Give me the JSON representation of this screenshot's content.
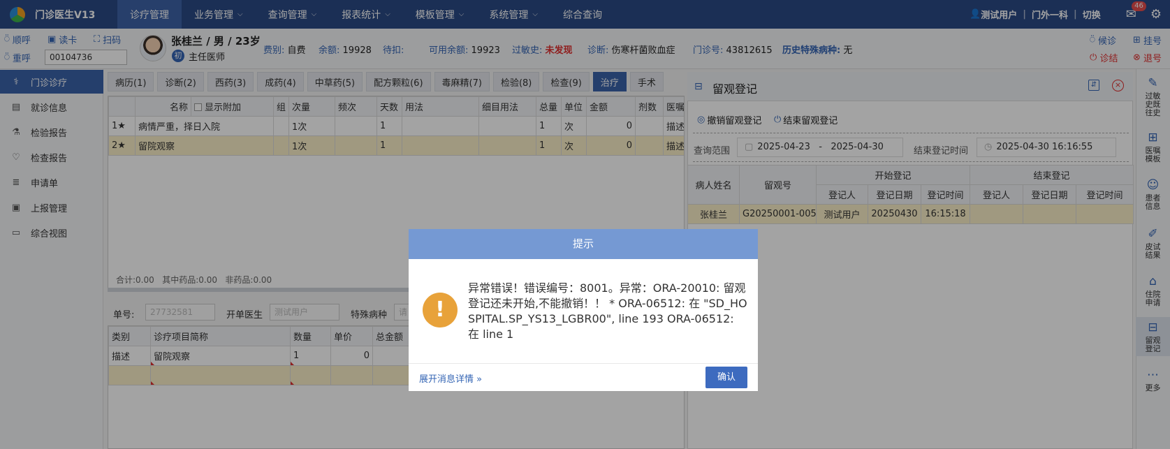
{
  "app": {
    "title": "门诊医生V13"
  },
  "nav": [
    {
      "label": "诊疗管理",
      "chev": false
    },
    {
      "label": "业务管理",
      "chev": true
    },
    {
      "label": "查询管理",
      "chev": true
    },
    {
      "label": "报表统计",
      "chev": true
    },
    {
      "label": "模板管理",
      "chev": true
    },
    {
      "label": "系统管理",
      "chev": true
    },
    {
      "label": "综合查询",
      "chev": false
    }
  ],
  "topright": {
    "user": "测试用户",
    "dept": "门外一科",
    "switch": "切换",
    "mail_count": "46"
  },
  "toolbar": {
    "shunhu": "顺呼",
    "duka": "读卡",
    "saoma": "扫码",
    "chonghu": "重呼",
    "card_no": "00104736"
  },
  "patient": {
    "name_line": "张桂兰 / 男 / 23岁",
    "chu": "初",
    "doctor_title": "主任医师",
    "fee_type_label": "费别:",
    "fee_type": "自费",
    "balance_label": "余额:",
    "balance": "19928",
    "deduct_label": "待扣:",
    "deduct": "",
    "avail_label": "可用余额:",
    "avail": "19923",
    "allergy_label": "过敏史:",
    "allergy": "未发现",
    "diag_label": "诊断:",
    "diag": "伤寒杆菌败血症",
    "visit_label": "门诊号:",
    "visit": "43812615",
    "special_label": "历史特殊病种:",
    "special": "无"
  },
  "right_tools": {
    "houzhen": "候诊",
    "guahao": "挂号",
    "zhenjie": "诊结",
    "tuihao": "退号"
  },
  "sidebar": [
    {
      "label": "门诊诊疗",
      "icon": "stethoscope-icon",
      "glyph": "⚕"
    },
    {
      "label": "就诊信息",
      "icon": "card-icon",
      "glyph": "▤"
    },
    {
      "label": "检验报告",
      "icon": "flask-icon",
      "glyph": "⚗"
    },
    {
      "label": "检查报告",
      "icon": "heart-icon",
      "glyph": "♡"
    },
    {
      "label": "申请单",
      "icon": "form-icon",
      "glyph": "≣"
    },
    {
      "label": "上报管理",
      "icon": "clipboard-icon",
      "glyph": "▣"
    },
    {
      "label": "综合视图",
      "icon": "monitor-icon",
      "glyph": "▭"
    }
  ],
  "tabs": [
    "病历(1)",
    "诊断(2)",
    "西药(3)",
    "成药(4)",
    "中草药(5)",
    "配方颗粒(6)",
    "毒麻精(7)",
    "检验(8)",
    "检查(9)",
    "治疗",
    "手术"
  ],
  "grid1": {
    "headers": [
      "",
      "名称",
      "显示附加",
      "组",
      "次量",
      "频次",
      "天数",
      "用法",
      "细目用法",
      "总量",
      "单位",
      "金额",
      "剂数",
      "医嘱"
    ],
    "rows": [
      [
        "1★",
        "病情严重，择日入院",
        "",
        "1次",
        "",
        "1",
        "",
        "",
        "1",
        "次",
        "0",
        "",
        "描述"
      ],
      [
        "2★",
        "留院观察",
        "",
        "1次",
        "",
        "1",
        "",
        "",
        "1",
        "次",
        "0",
        "",
        "描述"
      ]
    ],
    "footer": "合计:0.00   其中药品:0.00   非药品:0.00"
  },
  "lowerform": {
    "danhao_label": "单号:",
    "danhao": "27732581",
    "doctor_label": "开单医生",
    "doctor": "测试用户",
    "special_label": "特殊病种",
    "special": "请"
  },
  "grid2": {
    "headers": [
      "类别",
      "诊疗项目简称",
      "数量",
      "单价",
      "总金额"
    ],
    "rows": [
      [
        "描述",
        "留院观察",
        "1",
        "0",
        ""
      ]
    ]
  },
  "panel": {
    "title": "留观登记",
    "cancel_btn": "撤销留观登记",
    "end_btn": "结束留观登记",
    "range_label": "查询范围",
    "range": "2025-04-23   -   2025-04-30",
    "end_time_label": "结束登记时间",
    "end_time": "2025-04-30 16:16:55",
    "grid": {
      "group_start": "开始登记",
      "group_end": "结束登记",
      "col_name": "病人姓名",
      "col_no": "留观号",
      "sub": [
        "登记人",
        "登记日期",
        "登记时间",
        "登记人",
        "登记日期",
        "登记时间"
      ],
      "row": [
        "张桂兰",
        "G20250001-005",
        "测试用户",
        "20250430",
        "16:15:18",
        "",
        "",
        ""
      ]
    }
  },
  "rbar": [
    {
      "label": "过敏史既往史",
      "lines": [
        "过敏",
        "史既",
        "往史"
      ],
      "glyph": "✎"
    },
    {
      "label": "医嘱模板",
      "lines": [
        "医嘱",
        "模板"
      ],
      "glyph": "⊞"
    },
    {
      "label": "患者信息",
      "lines": [
        "患者",
        "信息"
      ],
      "glyph": "☺"
    },
    {
      "label": "皮试结果",
      "lines": [
        "皮试",
        "结果"
      ],
      "glyph": "✐"
    },
    {
      "label": "住院申请",
      "lines": [
        "住院",
        "申请"
      ],
      "glyph": "⌂"
    },
    {
      "label": "留观登记",
      "lines": [
        "留观",
        "登记"
      ],
      "glyph": "⊟"
    },
    {
      "label": "更多",
      "lines": [
        "更多"
      ],
      "glyph": "⋯"
    }
  ],
  "modal": {
    "title": "提示",
    "message": "异常错误！错误编号：8001。异常：ORA-20010: 留观登记还未开始,不能撤销！！ * ORA-06512: 在 \"SD_HOSPITAL.SP_YS13_LGBR00\", line 193 ORA-06512: 在 line 1",
    "detail_link": "展开消息详情",
    "ok": "确认"
  }
}
